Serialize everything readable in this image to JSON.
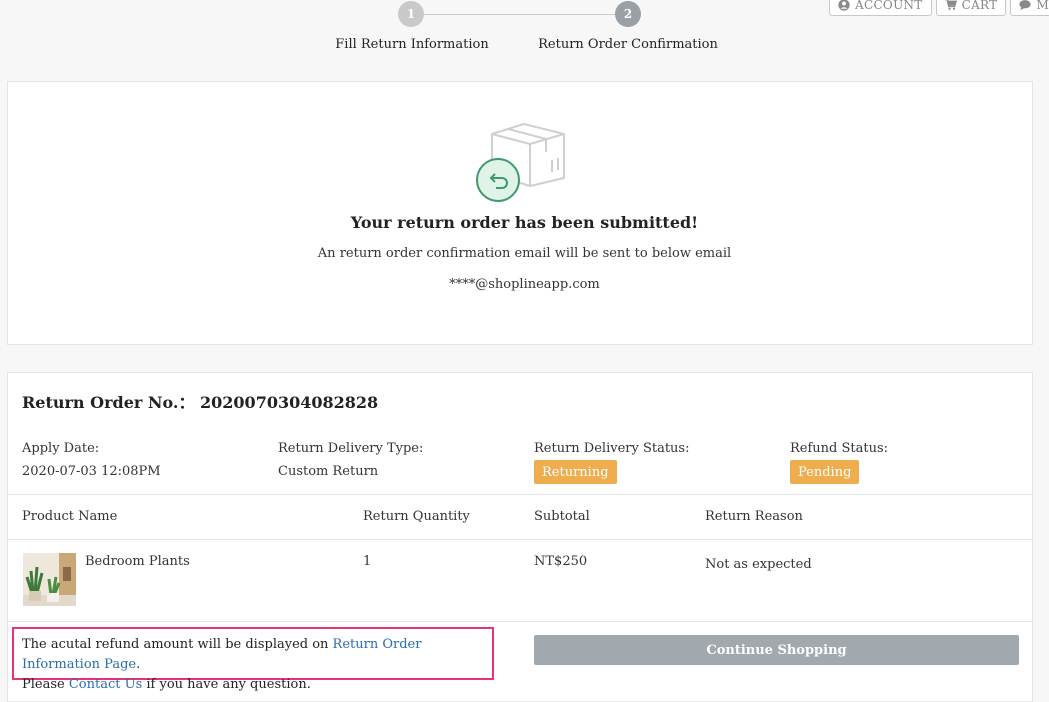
{
  "nav": {
    "account": "ACCOUNT",
    "cart": "CART",
    "message": "MES"
  },
  "stepper": {
    "steps": [
      {
        "number": "1",
        "label": "Fill Return Information"
      },
      {
        "number": "2",
        "label": "Return Order Confirmation"
      }
    ],
    "active_step": 2
  },
  "confirmation": {
    "title": "Your return order has been submitted!",
    "description": "An return order confirmation email will be sent to below email",
    "email": "****@shoplineapp.com"
  },
  "order": {
    "title": "Return Order No.： 2020070304082828",
    "apply_date_label": "Apply Date:",
    "apply_date": "2020-07-03 12:08PM",
    "delivery_type_label": "Return Delivery Type:",
    "delivery_type": "Custom Return",
    "delivery_status_label": "Return Delivery Status:",
    "delivery_status": "Returning",
    "refund_status_label": "Refund Status:",
    "refund_status": "Pending"
  },
  "table": {
    "headers": [
      "Product Name",
      "Return Quantity",
      "Subtotal",
      "Return Reason"
    ],
    "rows": [
      {
        "product": "Bedroom Plants",
        "quantity": "1",
        "subtotal": "NT$250",
        "reason": "Not as expected"
      }
    ]
  },
  "notice": {
    "text1": "The acutal refund amount will be displayed on ",
    "link1": "Return Order Information Page",
    "text2": ".",
    "text3": "Please ",
    "link2": "Contact Us",
    "text4": " if you have any question."
  },
  "continue_button": "Continue Shopping",
  "colors": {
    "badge": "#f0ad4e",
    "link": "#2a6db0",
    "highlight_border": "#e8327c",
    "button": "#a1a9ae",
    "return_icon": "#3d9a6a"
  }
}
